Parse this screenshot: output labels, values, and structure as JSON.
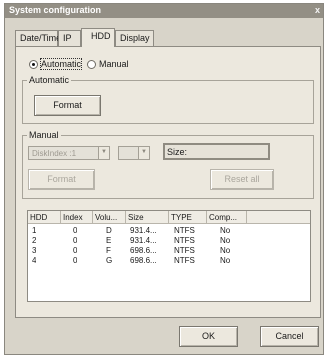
{
  "window": {
    "title": "System configuration",
    "close_glyph": "x"
  },
  "tabs": [
    {
      "label": "Date/Time"
    },
    {
      "label": "IP"
    },
    {
      "label": "HDD"
    },
    {
      "label": "Display"
    }
  ],
  "active_tab": "HDD",
  "mode": {
    "options": [
      {
        "label": "Automatic",
        "checked": true
      },
      {
        "label": "Manual",
        "checked": false
      }
    ]
  },
  "automatic": {
    "title": "Automatic",
    "format_label": "Format"
  },
  "manual": {
    "title": "Manual",
    "disk_select_value": "DiskIndex :1",
    "second_select_value": "",
    "size_label": "Size:",
    "format_label": "Format",
    "reset_label": "Reset all"
  },
  "table": {
    "columns": [
      "HDD",
      "Index",
      "Volu...",
      "Size",
      "TYPE",
      "Comp..."
    ],
    "rows": [
      [
        "1",
        "0",
        "D",
        "931.4...",
        "NTFS",
        "No"
      ],
      [
        "2",
        "0",
        "E",
        "931.4...",
        "NTFS",
        "No"
      ],
      [
        "3",
        "0",
        "F",
        "698.6...",
        "NTFS",
        "No"
      ],
      [
        "4",
        "0",
        "G",
        "698.6...",
        "NTFS",
        "No"
      ]
    ]
  },
  "footer": {
    "ok_label": "OK",
    "cancel_label": "Cancel"
  }
}
